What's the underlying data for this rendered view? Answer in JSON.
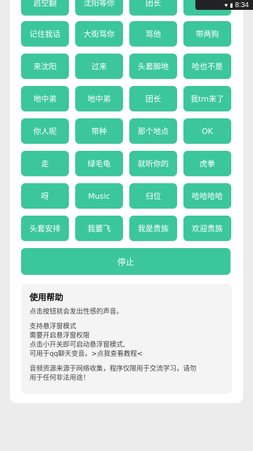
{
  "status_bar": {
    "time": "8:34"
  },
  "sound_buttons": [
    "启空翻",
    "沈阳等你",
    "团长",
    "",
    "记住我话",
    "大街骂你",
    "骂他",
    "带两狗",
    "来沈阳",
    "过来",
    "头套脚地",
    "哈也不是",
    "地中弟",
    "地中弟",
    "团长",
    "我tm来了",
    "你人呢",
    "带种",
    "那个地点",
    "OK",
    "走",
    "绿毛龟",
    "就听你的",
    "虎拳",
    "呀",
    "Music",
    "归位",
    "哈哈哈哈",
    "头套安排",
    "我要飞",
    "我是贵族",
    "欢迎贵族"
  ],
  "stop_button": "停止",
  "help": {
    "title": "使用帮助",
    "intro": "点击按钮就会发出性感的声音。",
    "float_lines": [
      "支持悬浮窗模式",
      "需要开启悬浮窗权限",
      "点击小开关即可启动悬浮窗模式,",
      "可用于qq聊天变音。>点我查看教程<"
    ],
    "disclaimer_lines": [
      "音频资源来源于网络收集，程序仅限用于交流学习，请勿",
      "用于任何非法用途！"
    ]
  },
  "colors": {
    "accent": "#3bc79a",
    "background": "#ececec",
    "card": "#ffffff"
  }
}
